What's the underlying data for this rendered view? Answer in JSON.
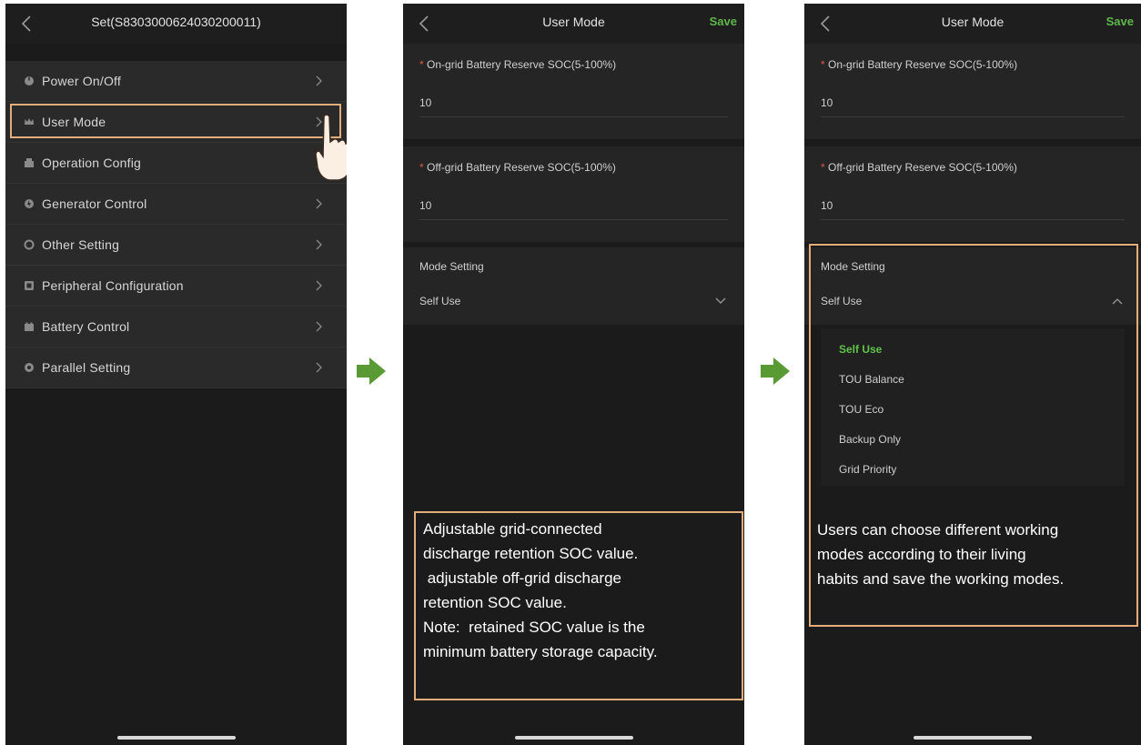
{
  "colors": {
    "accent_green": "#5fb84b",
    "highlight_orange": "#e2ad7a",
    "required_red": "#e05a4a",
    "arrow_green": "#5a9a35"
  },
  "screen1": {
    "title": "Set(S8303000624030200011)",
    "menu": [
      {
        "label": "Power On/Off",
        "icon": "power-icon"
      },
      {
        "label": "User Mode",
        "icon": "crown-icon"
      },
      {
        "label": "Operation Config",
        "icon": "config-icon"
      },
      {
        "label": "Generator Control",
        "icon": "generator-icon"
      },
      {
        "label": "Other Setting",
        "icon": "settings-icon"
      },
      {
        "label": "Peripheral Configuration",
        "icon": "peripheral-icon"
      },
      {
        "label": "Battery Control",
        "icon": "battery-icon"
      },
      {
        "label": "Parallel Setting",
        "icon": "parallel-icon"
      }
    ]
  },
  "screen2": {
    "title": "User Mode",
    "save_label": "Save",
    "on_grid": {
      "required": "*",
      "label": "On-grid Battery Reserve SOC(5-100%)",
      "value": "10"
    },
    "off_grid": {
      "required": "*",
      "label": "Off-grid Battery Reserve SOC(5-100%)",
      "value": "10"
    },
    "mode": {
      "label": "Mode Setting",
      "value": "Self Use"
    },
    "note_lines": [
      "Adjustable grid-connected",
      "discharge retention SOC value.",
      " adjustable off-grid discharge",
      "retention SOC value.",
      "Note:  retained SOC value is the",
      "minimum battery storage capacity."
    ]
  },
  "screen3": {
    "title": "User Mode",
    "save_label": "Save",
    "on_grid": {
      "required": "*",
      "label": "On-grid Battery Reserve SOC(5-100%)",
      "value": "10"
    },
    "off_grid": {
      "required": "*",
      "label": "Off-grid Battery Reserve SOC(5-100%)",
      "value": "10"
    },
    "mode": {
      "label": "Mode Setting",
      "value": "Self Use"
    },
    "options": [
      "Self Use",
      "TOU Balance",
      "TOU Eco",
      "Backup Only",
      "Grid Priority"
    ],
    "selected_option": "Self Use",
    "note_lines": [
      "Users can choose different working",
      "modes according to their living",
      "habits and save the working modes."
    ]
  }
}
